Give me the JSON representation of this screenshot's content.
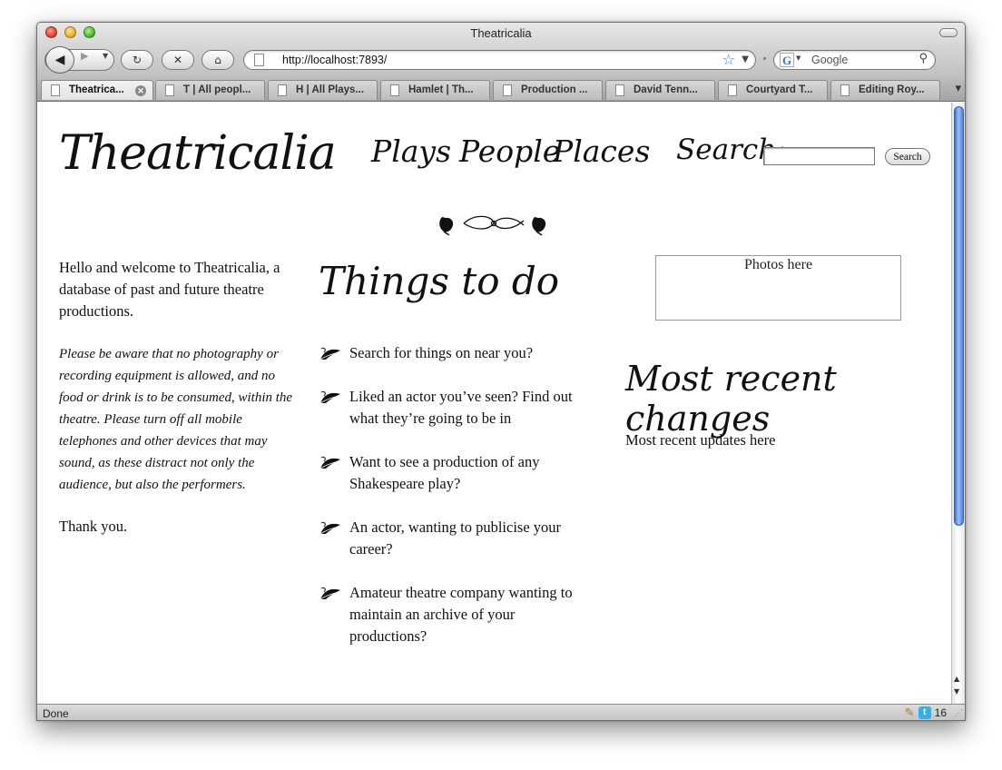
{
  "window": {
    "title": "Theatricalia"
  },
  "toolbar": {
    "url": "http://localhost:7893/",
    "search_engine_placeholder": "Google"
  },
  "tabs": [
    {
      "label": "Theatrica...",
      "active": true
    },
    {
      "label": "T | All peopl...",
      "active": false
    },
    {
      "label": "H | All Plays...",
      "active": false
    },
    {
      "label": "Hamlet | Th...",
      "active": false
    },
    {
      "label": "Production ...",
      "active": false
    },
    {
      "label": "David Tenn...",
      "active": false
    },
    {
      "label": "Courtyard T...",
      "active": false
    },
    {
      "label": "Editing Roy...",
      "active": false
    }
  ],
  "site": {
    "logo": "Theatricalia",
    "nav": {
      "plays": "Plays",
      "people": "People",
      "places": "Places"
    },
    "search_label": "Search:",
    "search_button": "Search",
    "search_value": ""
  },
  "intro": {
    "welcome": "Hello and welcome to Theatricalia, a database of past and future theatre productions.",
    "notice": "Please be aware that no photography or recording equipment is allowed, and no food or drink is to be consumed, within the theatre. Please turn off all mobile telephones and other devices that may sound, as these distract not only the audience, but also the performers.",
    "thanks": "Thank you."
  },
  "todo": {
    "title": "Things to do",
    "items": [
      "Search for things on near you?",
      "Liked an actor you’ve seen? Find out what they’re going to be in",
      "Want to see a production of any Shakespeare play?",
      "An actor, wanting to publicise your career?",
      "Amateur theatre company wanting to maintain an archive of your productions?"
    ]
  },
  "sidebar": {
    "photos": "Photos here",
    "recent_title": "Most recent changes",
    "recent_updates": "Most recent updates here"
  },
  "status": {
    "text": "Done",
    "twitter_count": "16"
  },
  "colors": {
    "scroll_thumb": "#4a7ee0",
    "star": "#3a7bd5"
  },
  "icons": [
    "back-icon",
    "forward-icon",
    "reload-icon",
    "stop-icon",
    "home-icon",
    "bookmark-star-icon",
    "google-icon",
    "magnifier-icon",
    "leaf-bullet-icon",
    "twitter-icon"
  ]
}
